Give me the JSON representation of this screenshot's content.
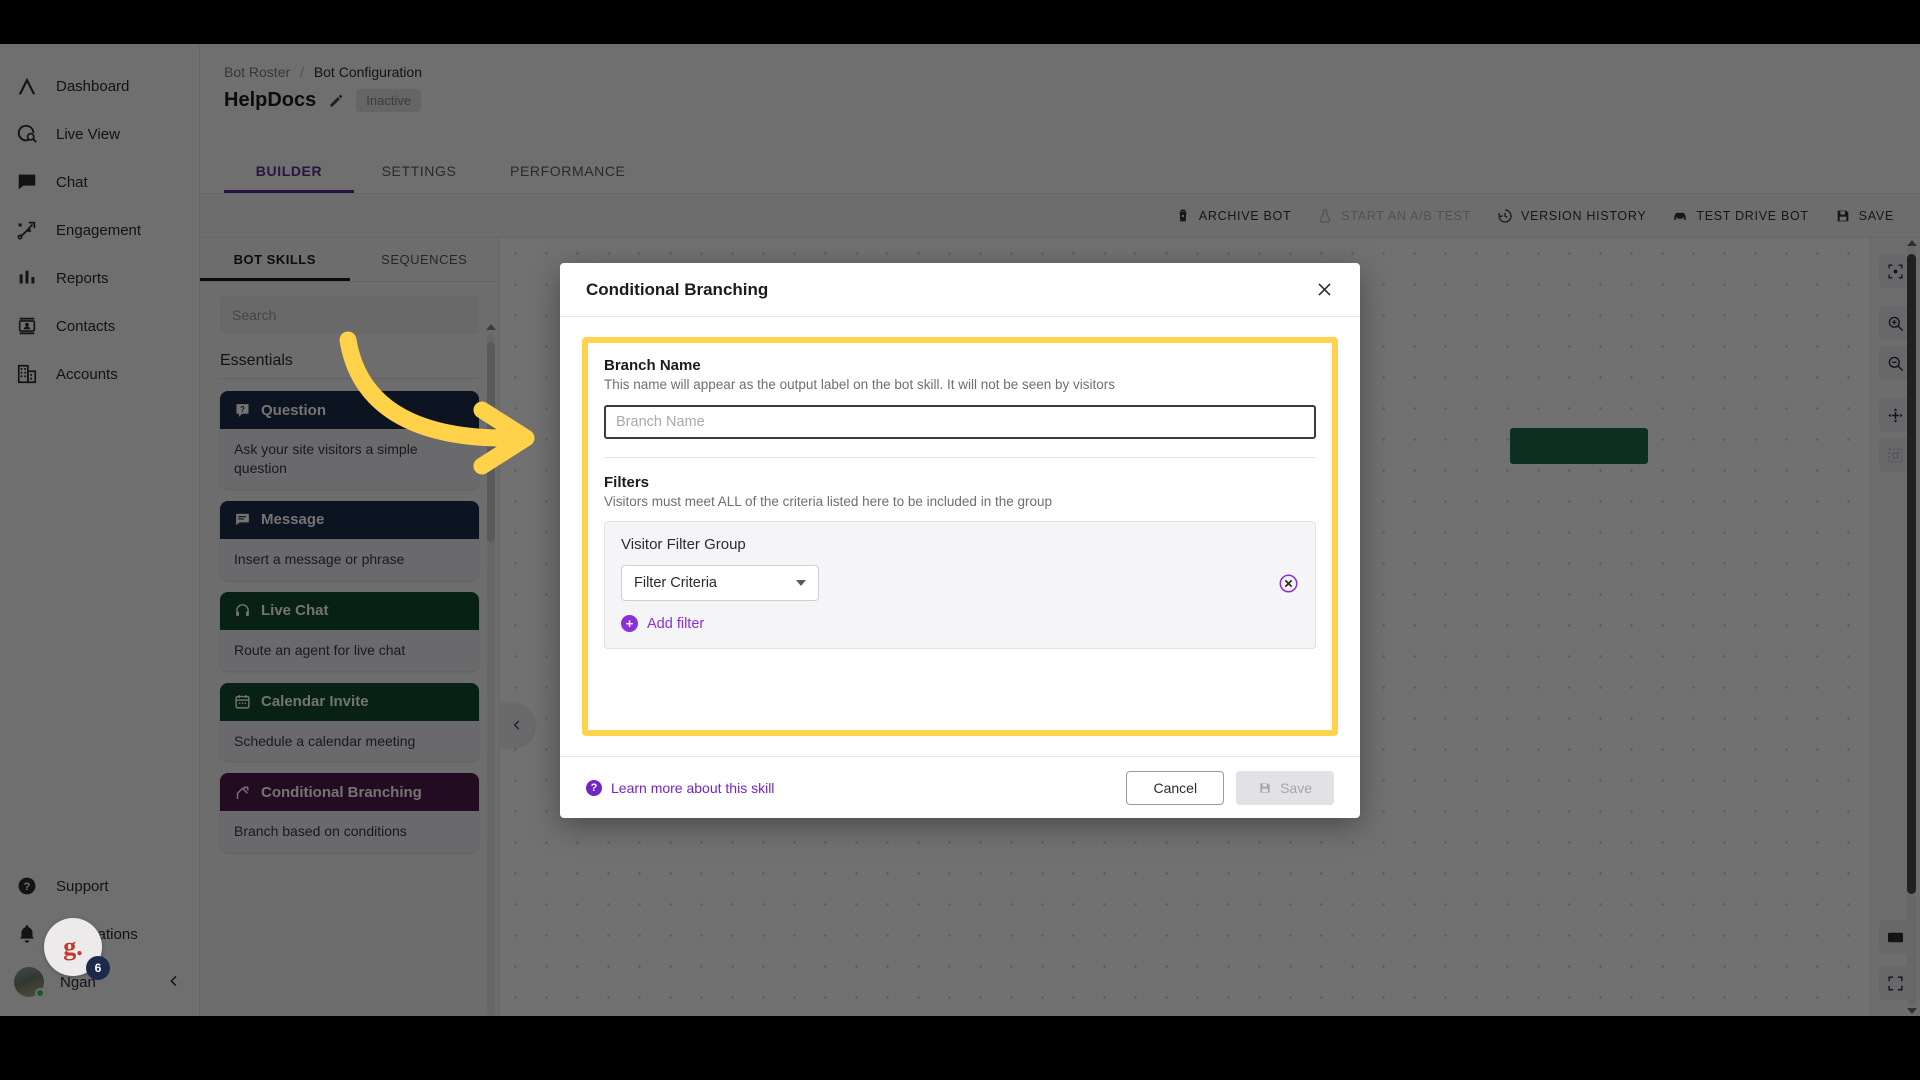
{
  "left_nav": {
    "top_items": [
      {
        "label": "Dashboard",
        "icon": "logo-chevron-icon"
      },
      {
        "label": "Live View",
        "icon": "live-view-icon"
      },
      {
        "label": "Chat",
        "icon": "chat-icon"
      },
      {
        "label": "Engagement",
        "icon": "engagement-icon"
      },
      {
        "label": "Reports",
        "icon": "reports-icon"
      },
      {
        "label": "Contacts",
        "icon": "contacts-icon"
      },
      {
        "label": "Accounts",
        "icon": "accounts-icon"
      }
    ],
    "bottom_items": [
      {
        "label": "Support",
        "icon": "help-circle-icon"
      },
      {
        "label": "Notifications",
        "icon": "bell-icon"
      }
    ],
    "user": {
      "name": "Ngan"
    },
    "floating_badge": {
      "initial": "g.",
      "count": "6"
    }
  },
  "header": {
    "breadcrumb": {
      "parent": "Bot Roster",
      "separator": "/",
      "current": "Bot Configuration"
    },
    "bot_name": "HelpDocs",
    "status": "Inactive",
    "tabs": [
      {
        "label": "BUILDER",
        "active": true
      },
      {
        "label": "SETTINGS",
        "active": false
      },
      {
        "label": "PERFORMANCE",
        "active": false
      }
    ]
  },
  "action_bar": {
    "actions": [
      {
        "label": "ARCHIVE BOT",
        "icon": "trash-icon",
        "disabled": false
      },
      {
        "label": "START AN A/B TEST",
        "icon": "flask-icon",
        "disabled": true
      },
      {
        "label": "VERSION HISTORY",
        "icon": "history-icon",
        "disabled": false
      },
      {
        "label": "TEST DRIVE BOT",
        "icon": "car-icon",
        "disabled": false
      },
      {
        "label": "SAVE",
        "icon": "save-icon",
        "disabled": false
      }
    ]
  },
  "skills_panel": {
    "tabs": [
      {
        "label": "BOT SKILLS",
        "active": true
      },
      {
        "label": "SEQUENCES",
        "active": false
      }
    ],
    "search_placeholder": "Search",
    "search_value": "",
    "group_title": "Essentials",
    "cards": [
      {
        "title": "Question",
        "description": "Ask your site visitors a simple question",
        "color": "#1c2b4a",
        "icon": "question-badge-icon"
      },
      {
        "title": "Message",
        "description": "Insert a message or phrase",
        "color": "#1c2b4a",
        "icon": "message-icon"
      },
      {
        "title": "Live Chat",
        "description": "Route an agent for live chat",
        "color": "#10492f",
        "icon": "headset-icon"
      },
      {
        "title": "Calendar Invite",
        "description": "Schedule a calendar meeting",
        "color": "#10492f",
        "icon": "calendar-icon"
      },
      {
        "title": "Conditional Branching",
        "description": "Branch based on conditions",
        "color": "#4d1b4d",
        "icon": "branch-icon"
      }
    ]
  },
  "rail": {
    "buttons": [
      {
        "icon": "focus-target-icon",
        "muted": false
      },
      {
        "icon": "zoom-in-icon",
        "muted": false
      },
      {
        "icon": "zoom-out-icon",
        "muted": false
      },
      {
        "icon": "move-icon",
        "muted": false
      },
      {
        "icon": "select-area-icon",
        "muted": true
      },
      {
        "icon": "keyboard-icon",
        "muted": false
      },
      {
        "icon": "fullscreen-icon",
        "muted": false
      }
    ]
  },
  "modal": {
    "title": "Conditional Branching",
    "close_icon": "close-icon",
    "branch": {
      "label": "Branch Name",
      "hint": "This name will appear as the output label on the bot skill. It will not be seen by visitors",
      "placeholder": "Branch Name",
      "value": ""
    },
    "filters": {
      "label": "Filters",
      "hint": "Visitors must meet ALL of the criteria listed here to be included in the group",
      "group_label": "Visitor Filter Group",
      "criteria_value": "Filter Criteria",
      "remove_icon": "remove-circle-icon",
      "add_filter_label": "Add filter"
    },
    "footer": {
      "learn_more": "Learn more about this skill",
      "cancel_label": "Cancel",
      "save_label": "Save"
    }
  },
  "colors": {
    "accent_purple": "#5c2d91",
    "link_purple": "#8b2fdb",
    "highlight_yellow": "#ffd34e",
    "canvas_node_green": "#1f6b4e"
  }
}
